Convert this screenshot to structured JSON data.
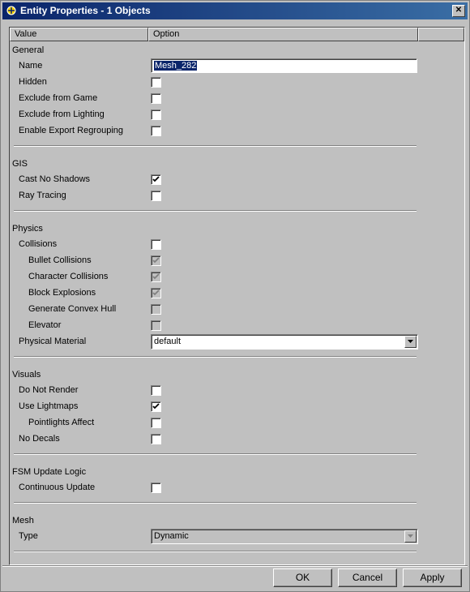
{
  "window": {
    "title": "Entity Properties - 1 Objects",
    "close_label": "✕"
  },
  "header": {
    "col_value": "Value",
    "col_option": "Option"
  },
  "sections": {
    "general": "General",
    "gis": "GIS",
    "physics": "Physics",
    "visuals": "Visuals",
    "fsm": "FSM Update Logic",
    "mesh": "Mesh"
  },
  "fields": {
    "name": {
      "label": "Name",
      "value": "Mesh_282"
    },
    "hidden": {
      "label": "Hidden",
      "checked": false
    },
    "exclude_game": {
      "label": "Exclude from Game",
      "checked": false
    },
    "exclude_lighting": {
      "label": "Exclude from Lighting",
      "checked": false
    },
    "export_regroup": {
      "label": "Enable Export Regrouping",
      "checked": false
    },
    "cast_no_shadows": {
      "label": "Cast No Shadows",
      "checked": true
    },
    "ray_tracing": {
      "label": "Ray Tracing",
      "checked": false
    },
    "collisions": {
      "label": "Collisions",
      "checked": false
    },
    "bullet_collisions": {
      "label": "Bullet Collisions",
      "checked": true,
      "disabled": true
    },
    "character_collisions": {
      "label": "Character Collisions",
      "checked": true,
      "disabled": true
    },
    "block_explosions": {
      "label": "Block Explosions",
      "checked": true,
      "disabled": true
    },
    "convex_hull": {
      "label": "Generate Convex Hull",
      "checked": false,
      "disabled": true
    },
    "elevator": {
      "label": "Elevator",
      "checked": false,
      "disabled": true
    },
    "physical_material": {
      "label": "Physical Material",
      "value": "default"
    },
    "do_not_render": {
      "label": "Do Not Render",
      "checked": false
    },
    "use_lightmaps": {
      "label": "Use Lightmaps",
      "checked": true
    },
    "pointlights_affect": {
      "label": "Pointlights Affect",
      "checked": false
    },
    "no_decals": {
      "label": "No Decals",
      "checked": false
    },
    "continuous_update": {
      "label": "Continuous Update",
      "checked": false
    },
    "type": {
      "label": "Type",
      "value": "Dynamic"
    }
  },
  "buttons": {
    "ok": "OK",
    "cancel": "Cancel",
    "apply": "Apply"
  },
  "colors": {
    "titlebar_start": "#0a246a",
    "titlebar_end": "#3a6ea5",
    "face": "#c0c0c0"
  }
}
